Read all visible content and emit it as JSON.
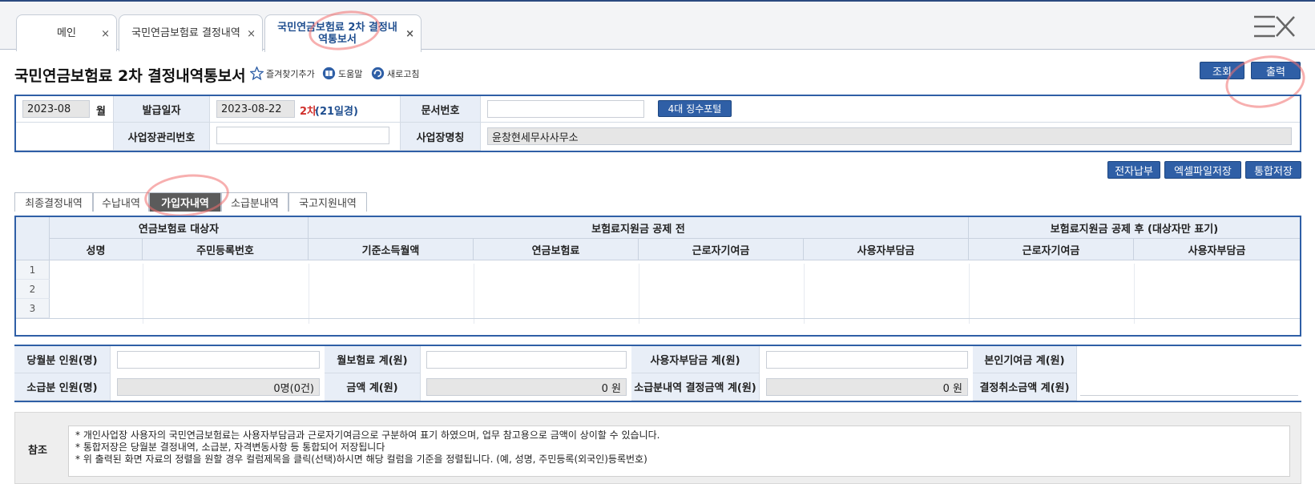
{
  "tabs": [
    {
      "label": "메인",
      "close": "×"
    },
    {
      "label": "국민연금보험료 결정내역",
      "close": "×"
    },
    {
      "label": "국민연금보험료 2차 결정내역통보서",
      "close": "×"
    }
  ],
  "title": "국민연금보험료 2차 결정내역통보서",
  "tools": {
    "favorite": "즐겨찾기추가",
    "help": "도움말",
    "refresh": "새로고침"
  },
  "buttons": {
    "search": "조회",
    "print": "출력",
    "portal": "4대 징수포털",
    "e_payment": "전자납부",
    "excel_save": "엑셀파일저장",
    "combined_save": "통합저장"
  },
  "form": {
    "month_value": "2023-08",
    "month_label": "월",
    "issue_date_label": "발급일자",
    "issue_date_value": "2023-08-22",
    "round": "2차",
    "round_detail": "(21일경)",
    "doc_no_label": "문서번호",
    "doc_no_value": "",
    "mgmt_no_label": "사업장관리번호",
    "mgmt_no_value": "",
    "business_name_label": "사업장명칭",
    "business_name_value": "윤창현세무사사무소"
  },
  "subtabs": [
    "최종결정내역",
    "수납내역",
    "가입자내역",
    "소급분내역",
    "국고지원내역"
  ],
  "grid": {
    "group_headers": [
      "연금보험료 대상자",
      "보험료지원금 공제 전",
      "보험료지원금 공제 후 (대상자만 표기)"
    ],
    "columns": [
      "성명",
      "주민등록번호",
      "기준소득월액",
      "연금보험료",
      "근로자기여금",
      "사용자부담금",
      "근로자기여금",
      "사용자부담금"
    ],
    "rows": [
      "1",
      "2",
      "3"
    ]
  },
  "summary": {
    "r1": [
      {
        "label": "당월분 인원(명)",
        "value": ""
      },
      {
        "label": "월보험료 계(원)",
        "value": ""
      },
      {
        "label": "사용자부담금 계(원)",
        "value": ""
      },
      {
        "label": "본인기여금 계(원)",
        "value": ""
      }
    ],
    "r2": [
      {
        "label": "소급분 인원(명)",
        "value": "0명(0건)"
      },
      {
        "label": "금액 계(원)",
        "value": "0 원"
      },
      {
        "label": "소급분내역 결정금액 계(원)",
        "value": "0 원"
      },
      {
        "label": "결정취소금액 계(원)",
        "value": ""
      }
    ]
  },
  "note": {
    "label": "참조",
    "lines": [
      "* 개인사업장 사용자의 국민연금보험료는 사용자부담금과 근로자기여금으로 구분하여 표기 하였으며, 업무 참고용으로 금액이 상이할 수 있습니다.",
      "* 통합저장은 당월분 결정내역, 소급분, 자격변동사항 등 통합되어 저장됩니다",
      "* 위 출력된 화면 자료의 정렬을 원할 경우 컬럼제목을 클릭(선택)하시면 해당 컬럼을 기준을 정렬됩니다. (예, 성명, 주민등록(외국인)등록번호)"
    ]
  },
  "colors": {
    "primary": "#2f5fa6",
    "header_bg": "#e8eef7",
    "round_red": "#d0312d",
    "round_blue": "#1f4e8f"
  },
  "icons": [
    "star-icon",
    "book-icon",
    "refresh-icon",
    "hamburger-close-icon"
  ]
}
